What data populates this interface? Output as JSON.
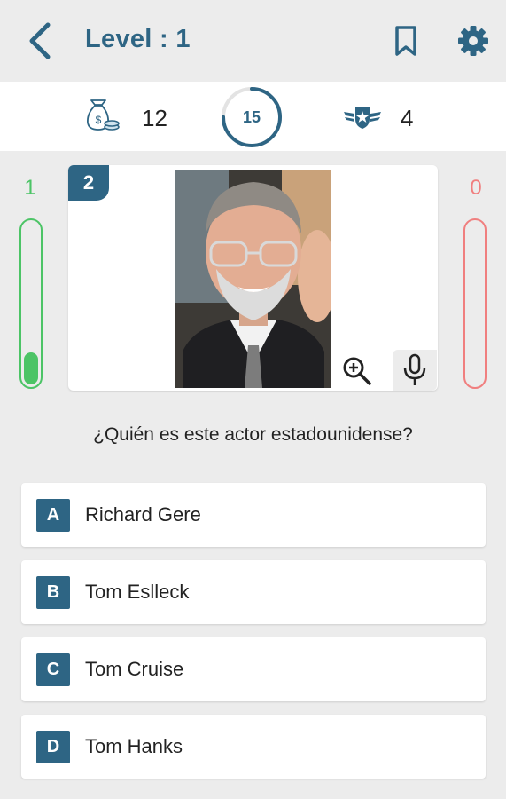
{
  "header": {
    "title": "Level : 1"
  },
  "stats": {
    "coins": "12",
    "timer": "15",
    "badges": "4",
    "timer_progress": 0.75
  },
  "score": {
    "correct": "1",
    "wrong": "0",
    "correct_fill": 0.2,
    "wrong_fill": 0
  },
  "question": {
    "number": "2",
    "text": "¿Quién es este actor estadounidense?"
  },
  "answers": [
    {
      "letter": "A",
      "label": "Richard Gere"
    },
    {
      "letter": "B",
      "label": "Tom Eslleck"
    },
    {
      "letter": "C",
      "label": "Tom Cruise"
    },
    {
      "letter": "D",
      "label": "Tom Hanks"
    }
  ],
  "colors": {
    "accent": "#2e6584",
    "correct": "#4cc466",
    "wrong": "#f07f7f",
    "background": "#ececec"
  },
  "icons": [
    "back-arrow-icon",
    "bookmark-icon",
    "gear-icon",
    "coin-bag-icon",
    "badge-icon",
    "zoom-in-icon",
    "microphone-icon"
  ]
}
